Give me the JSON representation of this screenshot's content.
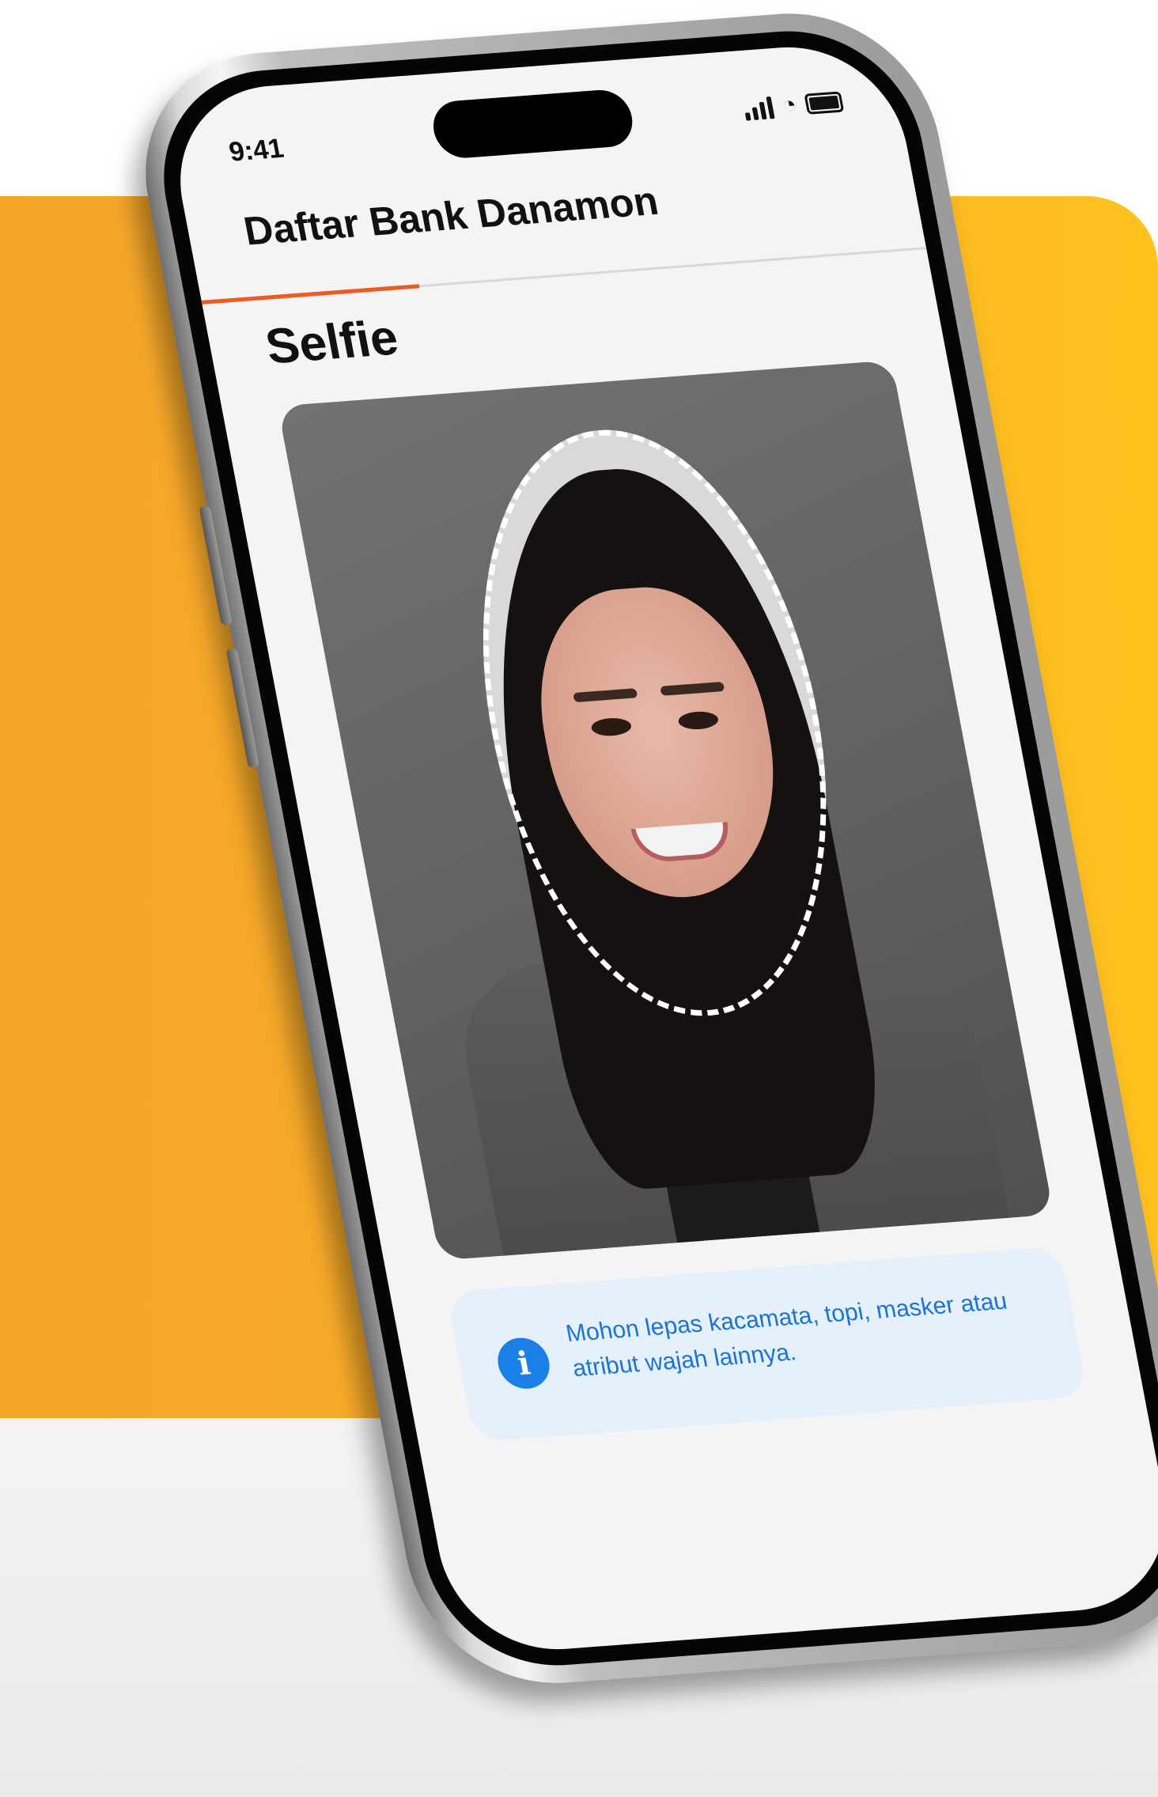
{
  "status_bar": {
    "time": "9:41"
  },
  "app": {
    "title": "Daftar Bank Danamon",
    "progress": 0.3
  },
  "page": {
    "title": "Selfie"
  },
  "notice": {
    "text": "Mohon lepas kacamata, topi, masker atau atribut wajah lainnya."
  },
  "icons": [
    "signal-icon",
    "wifi-icon",
    "battery-icon",
    "info-icon"
  ],
  "colors": {
    "accent_orange": "#f05a22",
    "info_blue": "#1a80e6",
    "info_background": "#e5f0fb",
    "background_orange": "#f8ae28",
    "background_yellow": "#ffc21e"
  }
}
